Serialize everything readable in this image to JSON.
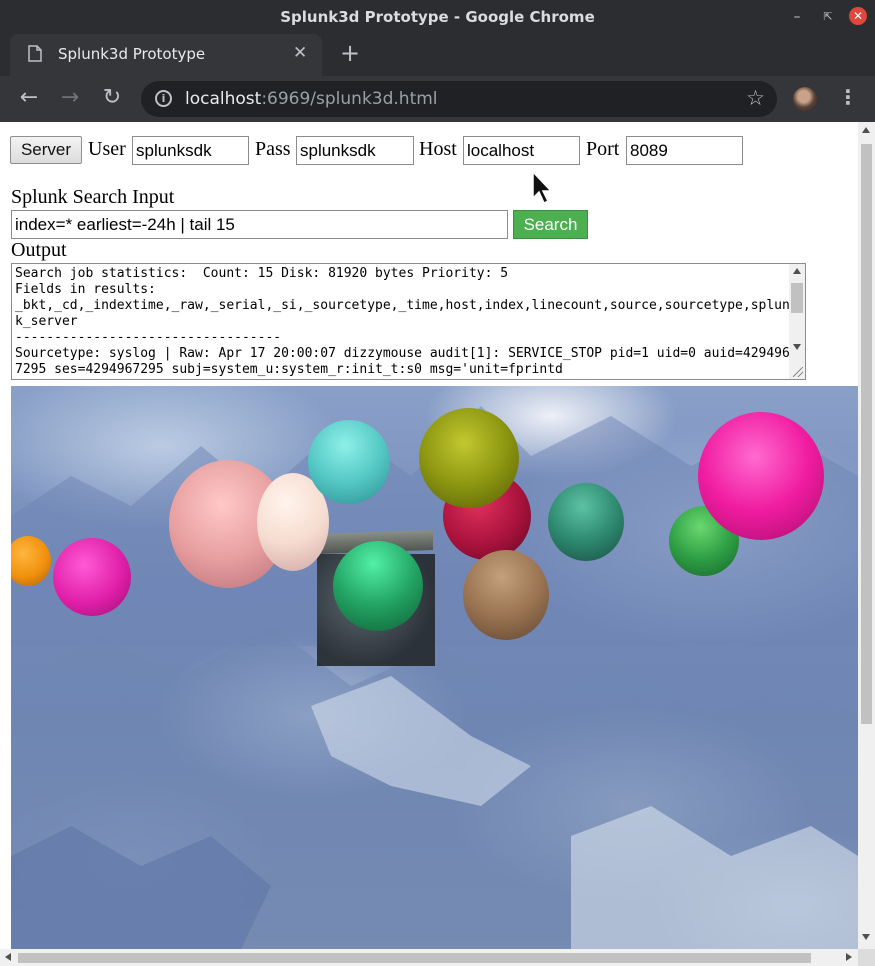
{
  "window": {
    "title": "Splunk3d Prototype - Google Chrome"
  },
  "tab": {
    "title": "Splunk3d Prototype"
  },
  "address": {
    "host": "localhost",
    "rest": ":6969/splunk3d.html"
  },
  "form": {
    "server_label": "Server",
    "user_label": "User",
    "user_value": "splunksdk",
    "pass_label": "Pass",
    "pass_value": "splunksdk",
    "host_label": "Host",
    "host_value": "localhost",
    "port_label": "Port",
    "port_value": "8089"
  },
  "search": {
    "heading": "Splunk Search Input",
    "query": "index=* earliest=-24h | tail 15",
    "button": "Search"
  },
  "output": {
    "heading": "Output",
    "text": "Search job statistics:  Count: 15 Disk: 81920 bytes Priority: 5\nFields in results:\n_bkt,_cd,_indextime,_raw,_serial,_si,_sourcetype,_time,host,index,linecount,source,sourcetype,splunk_server\n----------------------------------\nSourcetype: syslog | Raw: Apr 17 20:00:07 dizzymouse audit[1]: SERVICE_STOP pid=1 uid=0 auid=4294967295 ses=4294967295 subj=system_u:system_r:init_t:s0 msg='unit=fprintd"
  },
  "scene": {
    "spheres": [
      {
        "color": "#f0900c",
        "label": "orange-sphere"
      },
      {
        "color": "#e01fa8",
        "label": "magenta-sphere-left"
      },
      {
        "color": "#e8a0a0",
        "label": "pink-sphere"
      },
      {
        "color": "#f6dcd0",
        "label": "peach-sphere"
      },
      {
        "color": "#55c8c4",
        "label": "teal-sphere"
      },
      {
        "color": "#23a463",
        "label": "green-sphere-center"
      },
      {
        "color": "#a8123c",
        "label": "crimson-sphere"
      },
      {
        "color": "#8c9610",
        "label": "olive-sphere"
      },
      {
        "color": "#9a7452",
        "label": "brown-sphere"
      },
      {
        "color": "#2e8a70",
        "label": "dark-teal-sphere"
      },
      {
        "color": "#2fa045",
        "label": "green-sphere-right"
      },
      {
        "color": "#f01ca0",
        "label": "magenta-sphere-right"
      }
    ]
  }
}
